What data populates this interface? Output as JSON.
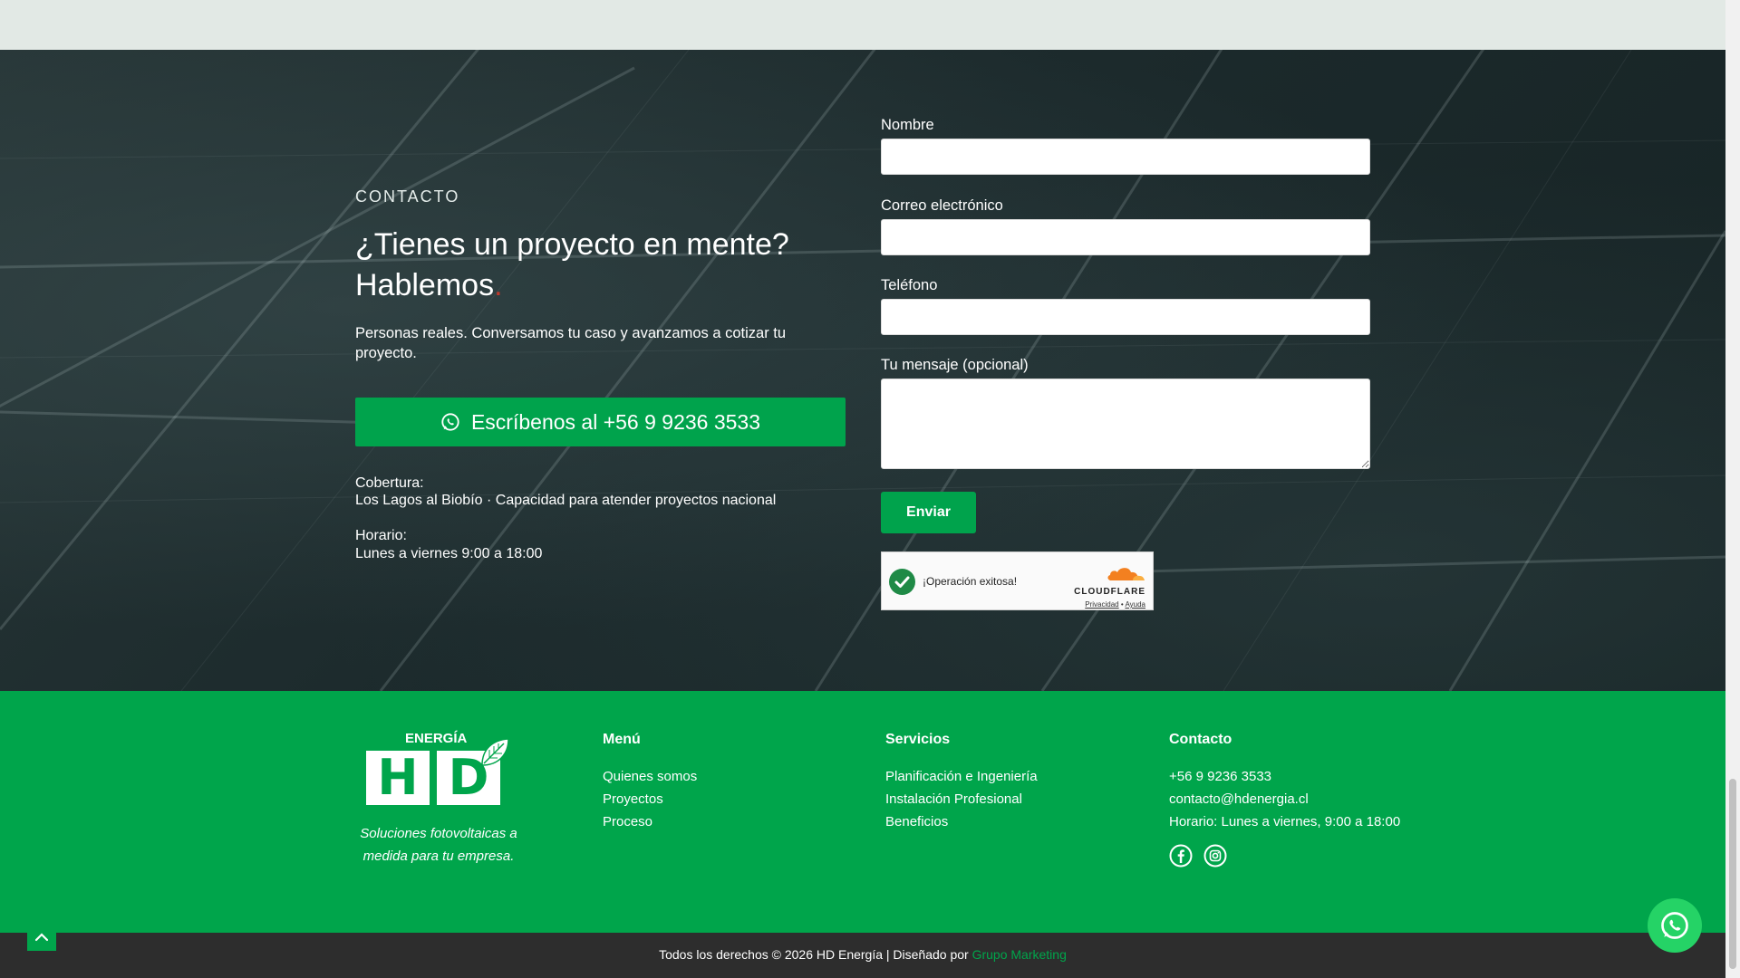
{
  "contact": {
    "eyebrow": "CONTACTO",
    "headline_line1": "¿Tienes un proyecto en mente?",
    "headline_line2": "Hablemos",
    "headline_dot": ".",
    "lead": "Personas reales. Conversamos tu caso y avanzamos a cotizar tu proyecto.",
    "whatsapp_label": "Escríbenos al +56 9 9236 3533",
    "coverage_label": "Cobertura:",
    "coverage_value": "Los Lagos al Biobío · Capacidad para atender proyectos nacional",
    "hours_label": "Horario:",
    "hours_value": "Lunes a viernes 9:00 a 18:00"
  },
  "form": {
    "name_label": "Nombre",
    "name_value": "",
    "email_label": "Correo electrónico",
    "email_value": "",
    "phone_label": "Teléfono",
    "phone_value": "",
    "message_label": "Tu mensaje (opcional)",
    "message_value": "",
    "submit_label": "Enviar"
  },
  "captcha": {
    "status": "¡Operación exitosa!",
    "provider": "CLOUDFLARE",
    "privacy": "Privacidad",
    "separator": "•",
    "help": "Ayuda"
  },
  "footer": {
    "logo_top": "ENERGÍA",
    "logo_h": "H",
    "logo_d": "D",
    "tagline": "Soluciones fotovoltaicas a medida para tu empresa.",
    "menu_title": "Menú",
    "menu_items": [
      "Quienes somos",
      "Proyectos",
      "Proceso"
    ],
    "services_title": "Servicios",
    "services_items": [
      "Planificación e Ingeniería",
      "Instalación Profesional",
      "Beneficios"
    ],
    "contact_title": "Contacto",
    "contact_phone": "+56 9 9236 3533",
    "contact_email": "contacto@hdenergia.cl",
    "contact_hours": "Horario: Lunes a viernes, 9:00 a 18:00",
    "social_icons": [
      "facebook-icon",
      "instagram-icon"
    ]
  },
  "bottom": {
    "copyright": "Todos los derechos © 2026 HD Energía | Diseñado por",
    "designer": "Grupo Marketing"
  },
  "colors": {
    "brand_green": "#00a54b",
    "button_green": "#00a34c",
    "whatsapp_green": "#25d366",
    "bottom_bar": "#2d2d2d",
    "top_strip": "#e2e9e5"
  }
}
